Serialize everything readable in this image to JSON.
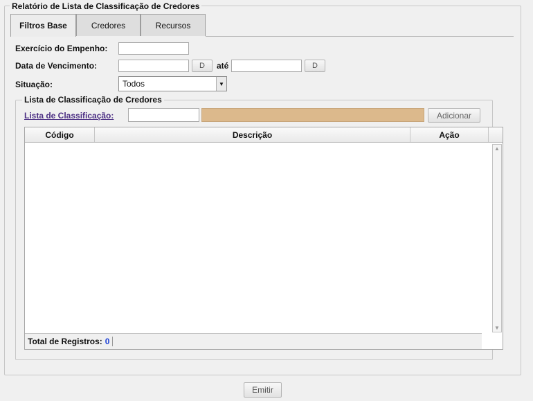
{
  "report": {
    "legend": "Relatório de Lista de Classificação de Credores",
    "tabs": [
      {
        "label": "Filtros Base",
        "active": true
      },
      {
        "label": "Credores",
        "active": false
      },
      {
        "label": "Recursos",
        "active": false
      }
    ],
    "fields": {
      "exercicio_label": "Exercício do Empenho:",
      "exercicio_value": "",
      "vencimento_label": "Data de Vencimento:",
      "date_button": "D",
      "ate_label": "até",
      "situacao_label": "Situação:",
      "situacao_value": "Todos"
    },
    "lista": {
      "legend": "Lista de Classificação de Credores",
      "link_label": "Lista de Classificação:",
      "add_button": "Adicionar",
      "columns": [
        "Código",
        "Descrição",
        "Ação"
      ],
      "rows": [],
      "total_label": "Total de Registros:",
      "total_value": "0"
    },
    "emit_button": "Emitir",
    "colors": {
      "description_field": "#dcb98c",
      "link": "#4b2e83",
      "count": "#1a3fd6"
    }
  }
}
